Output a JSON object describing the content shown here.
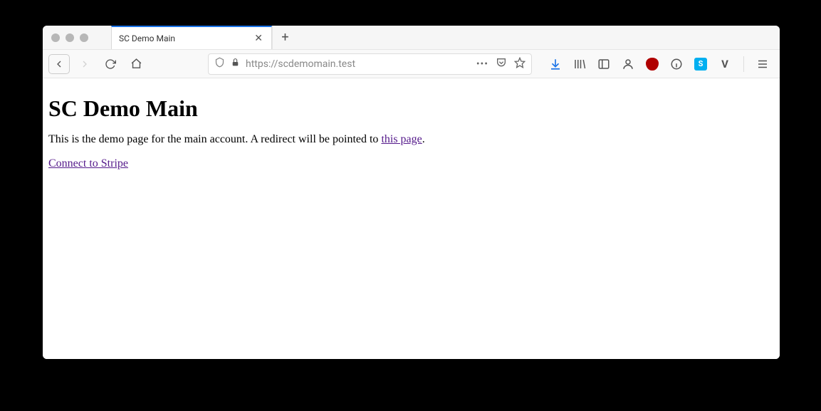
{
  "window": {
    "tabs": [
      {
        "title": "SC Demo Main"
      }
    ]
  },
  "toolbar": {
    "url_scheme": "https://",
    "url_host": "scdemomain.test"
  },
  "page": {
    "heading": "SC Demo Main",
    "intro_text_before_link": "This is the demo page for the main account. A redirect will be pointed to ",
    "intro_link_text": "this page",
    "intro_text_after_link": ".",
    "connect_link_text": "Connect to Stripe"
  }
}
